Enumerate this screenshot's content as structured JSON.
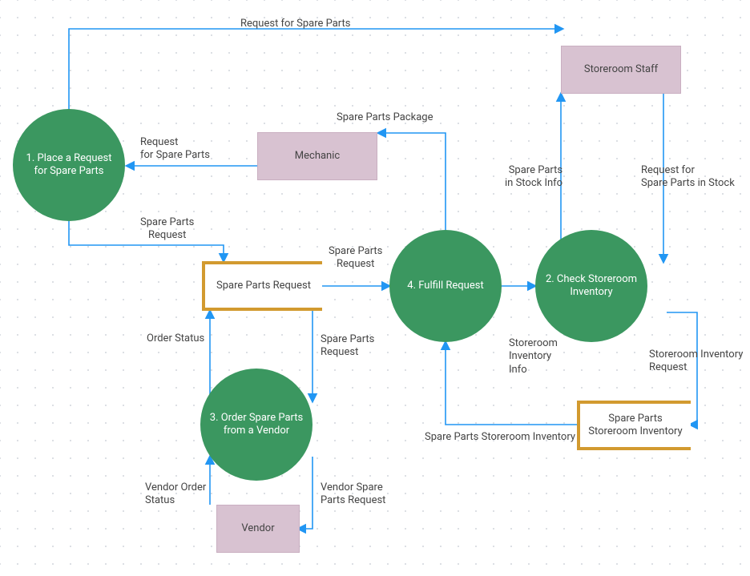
{
  "diagram": {
    "type": "data-flow-diagram",
    "colors": {
      "process": "#3b9760",
      "entity": "#d8c2d1",
      "store_border": "#d29a2f",
      "arrow": "#2196F3"
    }
  },
  "nodes": {
    "p1": "1. Place a Request for Spare Parts",
    "p2": "2. Check Storeroom Inventory",
    "p3": "3. Order Spare Parts from a Vendor",
    "p4": "4. Fulfill Request",
    "mechanic": "Mechanic",
    "storeroom_staff": "Storeroom Staff",
    "vendor": "Vendor",
    "ds_request": "Spare Parts Request",
    "ds_inventory": "Spare Parts Storeroom Inventory"
  },
  "edges": {
    "e1": "Request for Spare Parts",
    "e2": "Request\nfor Spare Parts",
    "e3": "Spare Parts\nRequest",
    "e4": "Spare Parts\nRequest",
    "e5": "Spare Parts\nRequest",
    "e6": "Spare Parts Package",
    "e7": "Order Status",
    "e8": "Vendor Spare\nParts Request",
    "e9": "Vendor Order\nStatus",
    "e10": "Spare Parts Storeroom Inventory",
    "e11": "Storeroom\nInventory\nInfo",
    "e12": "Storeroom Inventory\nRequest",
    "e13": "Spare Parts\nin Stock Info",
    "e14": "Request for\nSpare Parts in Stock"
  }
}
